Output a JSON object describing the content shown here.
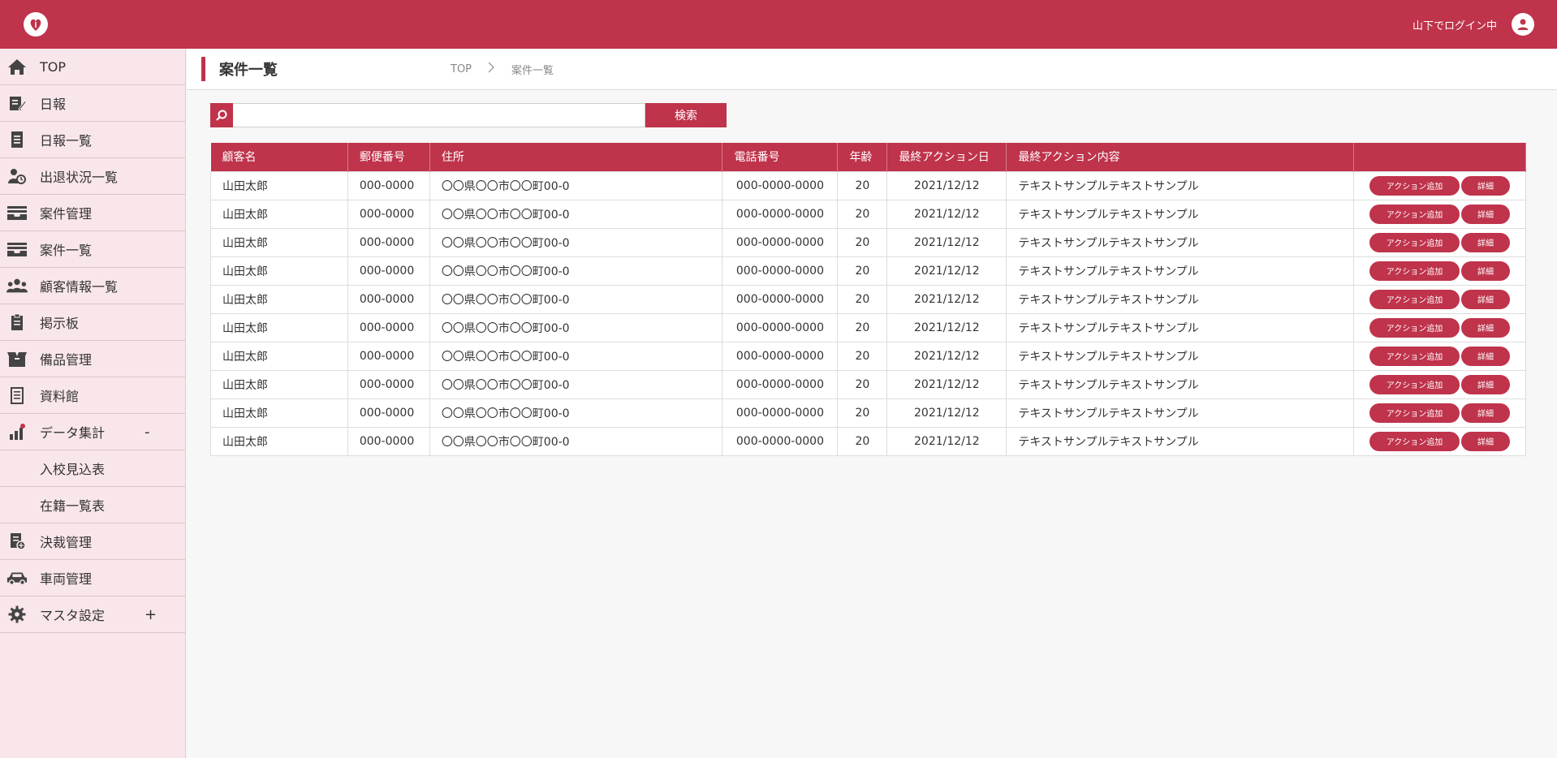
{
  "header": {
    "login_text": "山下でログイン中",
    "accent": "#bf334b"
  },
  "sidebar": {
    "items": [
      {
        "label": "TOP",
        "icon": "home-icon"
      },
      {
        "label": "日報",
        "icon": "edit-icon"
      },
      {
        "label": "日報一覧",
        "icon": "document-icon"
      },
      {
        "label": "出退状況一覧",
        "icon": "user-clock-icon"
      },
      {
        "label": "案件管理",
        "icon": "inbox-icon"
      },
      {
        "label": "案件一覧",
        "icon": "inbox-icon"
      },
      {
        "label": "顧客情報一覧",
        "icon": "users-icon"
      },
      {
        "label": "掲示板",
        "icon": "clipboard-icon"
      },
      {
        "label": "備品管理",
        "icon": "box-icon"
      },
      {
        "label": "資料館",
        "icon": "files-icon"
      },
      {
        "label": "データ集計",
        "icon": "chart-icon",
        "toggle": "-"
      },
      {
        "label": "入校見込表"
      },
      {
        "label": "在籍一覧表"
      },
      {
        "label": "決裁管理",
        "icon": "approval-icon"
      },
      {
        "label": "車両管理",
        "icon": "car-icon"
      },
      {
        "label": "マスタ設定",
        "icon": "gear-icon",
        "toggle": "+"
      }
    ]
  },
  "main": {
    "title": "案件一覧",
    "breadcrumb": [
      "TOP",
      "案件一覧"
    ],
    "search": {
      "value": "",
      "button_label": "検索"
    }
  },
  "table": {
    "headers": [
      "顧客名",
      "郵便番号",
      "住所",
      "電話番号",
      "年齢",
      "最終アクション日",
      "最終アクション内容",
      ""
    ],
    "action_label": "アクション追加",
    "detail_label": "詳細",
    "rows": [
      [
        "山田太郎",
        "000-0000",
        "〇〇県〇〇市〇〇町00-0",
        "000-0000-0000",
        "20",
        "2021/12/12",
        "テキストサンプルテキストサンプル"
      ],
      [
        "山田太郎",
        "000-0000",
        "〇〇県〇〇市〇〇町00-0",
        "000-0000-0000",
        "20",
        "2021/12/12",
        "テキストサンプルテキストサンプル"
      ],
      [
        "山田太郎",
        "000-0000",
        "〇〇県〇〇市〇〇町00-0",
        "000-0000-0000",
        "20",
        "2021/12/12",
        "テキストサンプルテキストサンプル"
      ],
      [
        "山田太郎",
        "000-0000",
        "〇〇県〇〇市〇〇町00-0",
        "000-0000-0000",
        "20",
        "2021/12/12",
        "テキストサンプルテキストサンプル"
      ],
      [
        "山田太郎",
        "000-0000",
        "〇〇県〇〇市〇〇町00-0",
        "000-0000-0000",
        "20",
        "2021/12/12",
        "テキストサンプルテキストサンプル"
      ],
      [
        "山田太郎",
        "000-0000",
        "〇〇県〇〇市〇〇町00-0",
        "000-0000-0000",
        "20",
        "2021/12/12",
        "テキストサンプルテキストサンプル"
      ],
      [
        "山田太郎",
        "000-0000",
        "〇〇県〇〇市〇〇町00-0",
        "000-0000-0000",
        "20",
        "2021/12/12",
        "テキストサンプルテキストサンプル"
      ],
      [
        "山田太郎",
        "000-0000",
        "〇〇県〇〇市〇〇町00-0",
        "000-0000-0000",
        "20",
        "2021/12/12",
        "テキストサンプルテキストサンプル"
      ],
      [
        "山田太郎",
        "000-0000",
        "〇〇県〇〇市〇〇町00-0",
        "000-0000-0000",
        "20",
        "2021/12/12",
        "テキストサンプルテキストサンプル"
      ],
      [
        "山田太郎",
        "000-0000",
        "〇〇県〇〇市〇〇町00-0",
        "000-0000-0000",
        "20",
        "2021/12/12",
        "テキストサンプルテキストサンプル"
      ]
    ]
  }
}
